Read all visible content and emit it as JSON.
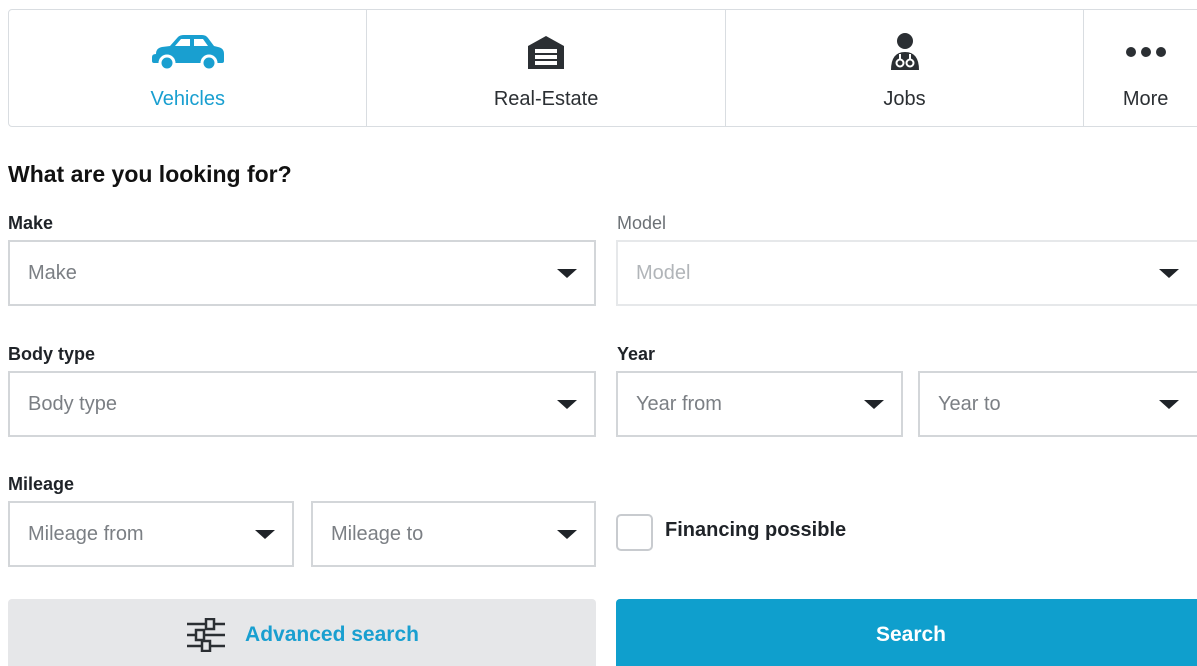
{
  "tabs": [
    {
      "label": "Vehicles",
      "icon": "car-icon",
      "active": true
    },
    {
      "label": "Real-Estate",
      "icon": "garage-icon",
      "active": false
    },
    {
      "label": "Jobs",
      "icon": "doctor-icon",
      "active": false
    },
    {
      "label": "More",
      "icon": "more-dots-icon",
      "active": false
    }
  ],
  "form": {
    "heading": "What are you looking for?",
    "make": {
      "label": "Make",
      "placeholder": "Make"
    },
    "model": {
      "label": "Model",
      "placeholder": "Model",
      "disabled": true
    },
    "body_type": {
      "label": "Body type",
      "placeholder": "Body type"
    },
    "year": {
      "label": "Year",
      "from_placeholder": "Year from",
      "to_placeholder": "Year to"
    },
    "mileage": {
      "label": "Mileage",
      "from_placeholder": "Mileage from",
      "to_placeholder": "Mileage to"
    },
    "financing": {
      "label": "Financing possible",
      "checked": false
    }
  },
  "buttons": {
    "advanced_search": "Advanced search",
    "search": "Search"
  },
  "colors": {
    "accent": "#199fd0",
    "search_button": "#0f9fcd",
    "advanced_bg": "#e6e7e9"
  }
}
